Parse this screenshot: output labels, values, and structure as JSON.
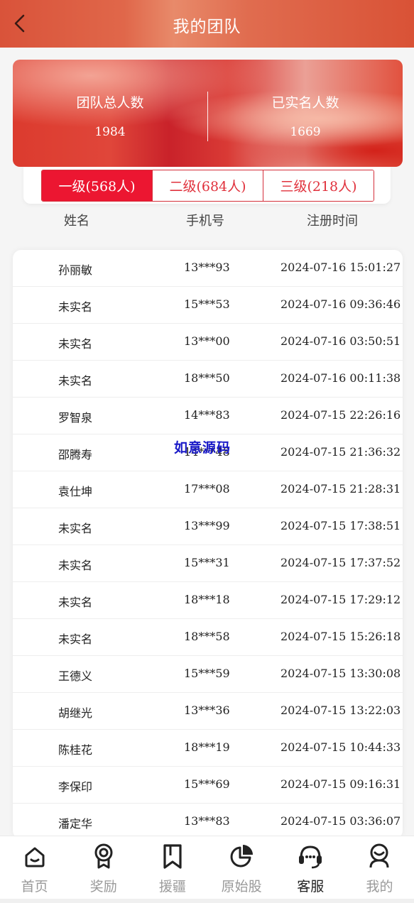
{
  "header": {
    "title": "我的团队"
  },
  "stats": {
    "total_label": "团队总人数",
    "total_value": "1984",
    "verified_label": "已实名人数",
    "verified_value": "1669"
  },
  "tabs": [
    {
      "label": "一级(568人)",
      "active": true
    },
    {
      "label": "二级(684人)",
      "active": false
    },
    {
      "label": "三级(218人)",
      "active": false
    }
  ],
  "columns": {
    "name": "姓名",
    "phone": "手机号",
    "time": "注册时间"
  },
  "rows": [
    {
      "name": "孙丽敏",
      "phone": "13***93",
      "time": "2024-07-16 15:01:27"
    },
    {
      "name": "未实名",
      "phone": "15***53",
      "time": "2024-07-16 09:36:46"
    },
    {
      "name": "未实名",
      "phone": "13***00",
      "time": "2024-07-16 03:50:51"
    },
    {
      "name": "未实名",
      "phone": "18***50",
      "time": "2024-07-16 00:11:38"
    },
    {
      "name": "罗智泉",
      "phone": "14***83",
      "time": "2024-07-15 22:26:16"
    },
    {
      "name": "邵腾寿",
      "phone": "14***48",
      "time": "2024-07-15 21:36:32"
    },
    {
      "name": "袁仕坤",
      "phone": "17***08",
      "time": "2024-07-15 21:28:31"
    },
    {
      "name": "未实名",
      "phone": "13***99",
      "time": "2024-07-15 17:38:51"
    },
    {
      "name": "未实名",
      "phone": "15***31",
      "time": "2024-07-15 17:37:52"
    },
    {
      "name": "未实名",
      "phone": "18***18",
      "time": "2024-07-15 17:29:12"
    },
    {
      "name": "未实名",
      "phone": "18***58",
      "time": "2024-07-15 15:26:18"
    },
    {
      "name": "王德义",
      "phone": "15***59",
      "time": "2024-07-15 13:30:08"
    },
    {
      "name": "胡继光",
      "phone": "13***36",
      "time": "2024-07-15 13:22:03"
    },
    {
      "name": "陈桂花",
      "phone": "18***19",
      "time": "2024-07-15 10:44:33"
    },
    {
      "name": "李保印",
      "phone": "15***69",
      "time": "2024-07-15 09:16:31"
    },
    {
      "name": "潘定华",
      "phone": "13***83",
      "time": "2024-07-15 03:36:07"
    }
  ],
  "watermark": "如意源码",
  "nav": [
    {
      "label": "首页",
      "icon": "home-icon",
      "active": false
    },
    {
      "label": "奖励",
      "icon": "medal-icon",
      "active": false
    },
    {
      "label": "援疆",
      "icon": "bookmark-icon",
      "active": false
    },
    {
      "label": "原始股",
      "icon": "pie-chart-icon",
      "active": false
    },
    {
      "label": "客服",
      "icon": "headset-icon",
      "active": true
    },
    {
      "label": "我的",
      "icon": "user-icon",
      "active": false
    }
  ],
  "colors": {
    "accent": "#ec1631",
    "header": "#d9533a"
  }
}
